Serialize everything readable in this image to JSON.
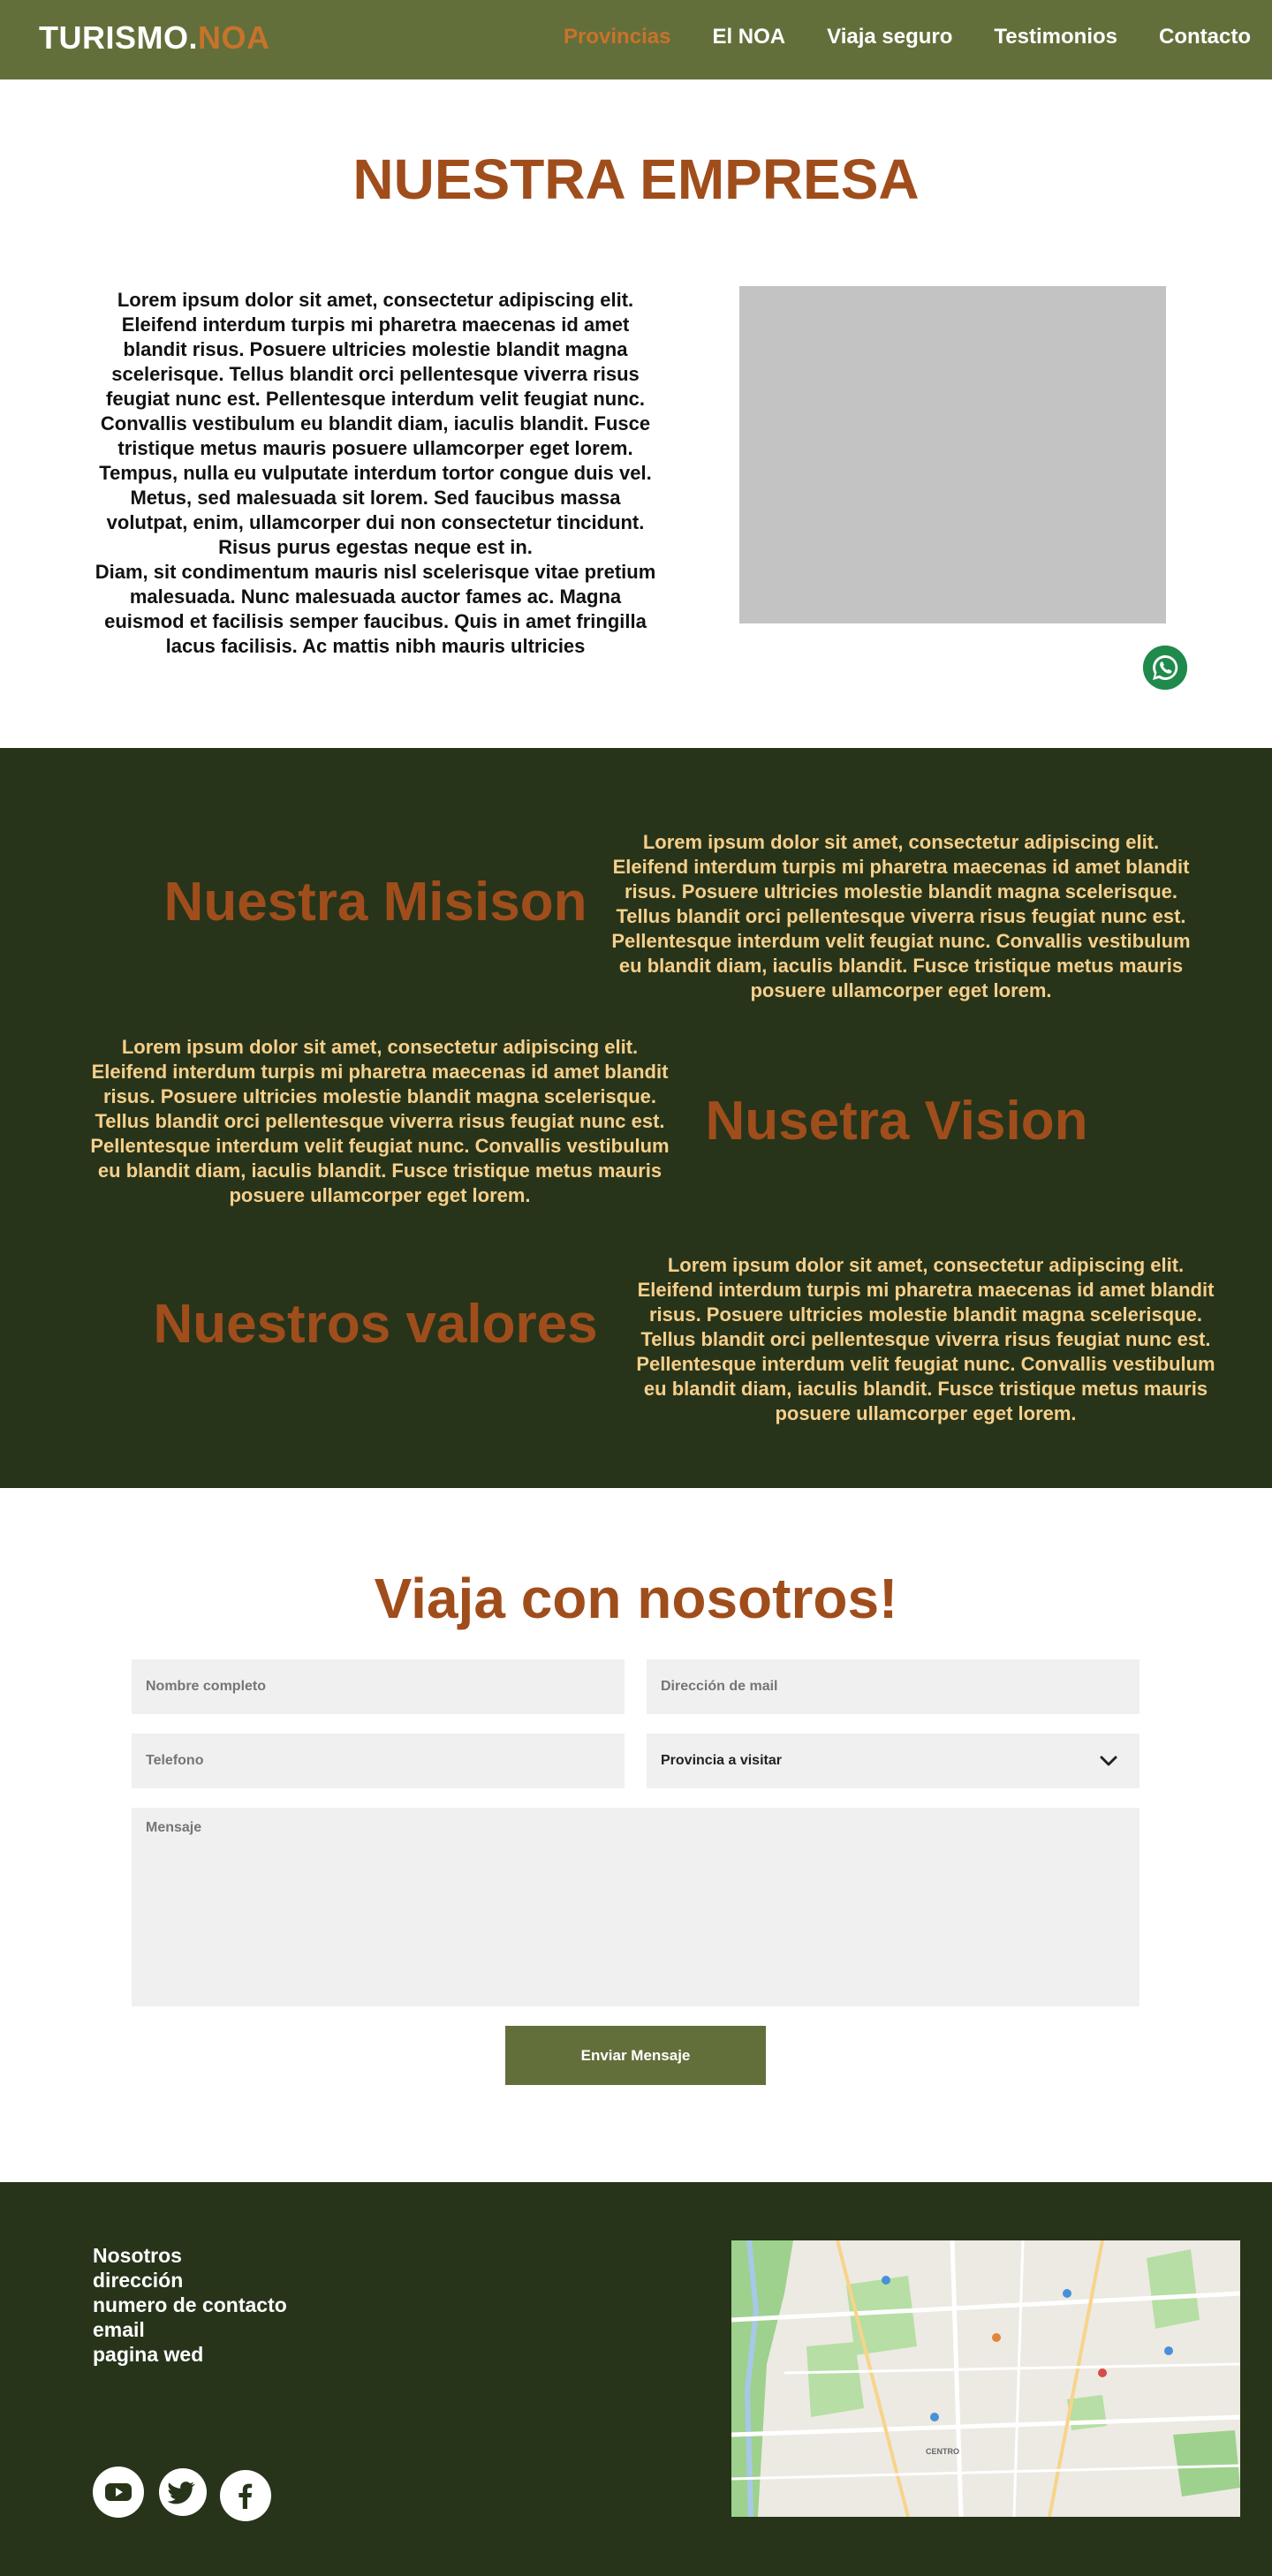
{
  "header": {
    "logo_main": "TURISMO.",
    "logo_accent": "NOA",
    "nav": [
      "Provincias",
      "El NOA",
      "Viaja seguro",
      "Testimonios",
      "Contacto"
    ]
  },
  "empresa": {
    "title": "NUESTRA EMPRESA",
    "text_1": "Lorem ipsum dolor sit amet, consectetur adipiscing elit. Eleifend interdum turpis mi pharetra maecenas id amet blandit risus. Posuere ultricies molestie blandit magna scelerisque. Tellus blandit orci pellentesque viverra risus feugiat nunc est. Pellentesque interdum velit feugiat nunc. Convallis vestibulum eu blandit diam, iaculis blandit. Fusce tristique metus mauris posuere ullamcorper eget lorem. Tempus, nulla eu vulputate interdum tortor congue duis vel. Metus, sed malesuada sit lorem. Sed faucibus massa volutpat, enim, ullamcorper dui non consectetur tincidunt. Risus purus egestas neque est in.",
    "text_2": "Diam, sit condimentum mauris nisl scelerisque vitae pretium malesuada. Nunc malesuada auctor fames ac. Magna euismod et facilisis semper faucibus. Quis in amet fringilla lacus facilisis. Ac mattis nibh mauris ultricies"
  },
  "mision": {
    "title": "Nuestra Misison",
    "text": "Lorem ipsum dolor sit amet, consectetur adipiscing elit. Eleifend interdum turpis mi pharetra maecenas id amet blandit risus. Posuere ultricies molestie blandit magna scelerisque. Tellus blandit orci pellentesque viverra risus feugiat nunc est. Pellentesque interdum velit feugiat nunc. Convallis vestibulum eu blandit diam, iaculis blandit. Fusce tristique metus mauris posuere ullamcorper eget lorem."
  },
  "vision": {
    "title": "Nusetra Vision",
    "text": "Lorem ipsum dolor sit amet, consectetur adipiscing elit. Eleifend interdum turpis mi pharetra maecenas id amet blandit risus. Posuere ultricies molestie blandit magna scelerisque. Tellus blandit orci pellentesque viverra risus feugiat nunc est. Pellentesque interdum velit feugiat nunc. Convallis vestibulum eu blandit diam, iaculis blandit. Fusce tristique metus mauris posuere ullamcorper eget lorem."
  },
  "valores": {
    "title": "Nuestros valores",
    "text": "Lorem ipsum dolor sit amet, consectetur adipiscing elit. Eleifend interdum turpis mi pharetra maecenas id amet blandit risus. Posuere ultricies molestie blandit magna scelerisque. Tellus blandit orci pellentesque viverra risus feugiat nunc est. Pellentesque interdum velit feugiat nunc. Convallis vestibulum eu blandit diam, iaculis blandit. Fusce tristique metus mauris posuere ullamcorper eget lorem."
  },
  "form": {
    "title": "Viaja con nosotros!",
    "name_placeholder": "Nombre completo",
    "email_placeholder": "Dirección de mail",
    "phone_placeholder": "Telefono",
    "province_placeholder": "Provincia a visitar",
    "message_placeholder": "Mensaje",
    "submit": "Enviar Mensaje"
  },
  "footer": {
    "links": [
      "Nosotros",
      "dirección",
      "numero de contacto",
      "email",
      "pagina wed"
    ],
    "social": [
      "youtube-icon",
      "twitter-icon",
      "facebook-icon"
    ],
    "map_label": "CENTRO"
  },
  "colors": {
    "header_bg": "#636f3a",
    "accent": "#c8732a",
    "title": "#a04d1c",
    "dark_bg": "#27341a",
    "light_text": "#f7cf8a"
  }
}
